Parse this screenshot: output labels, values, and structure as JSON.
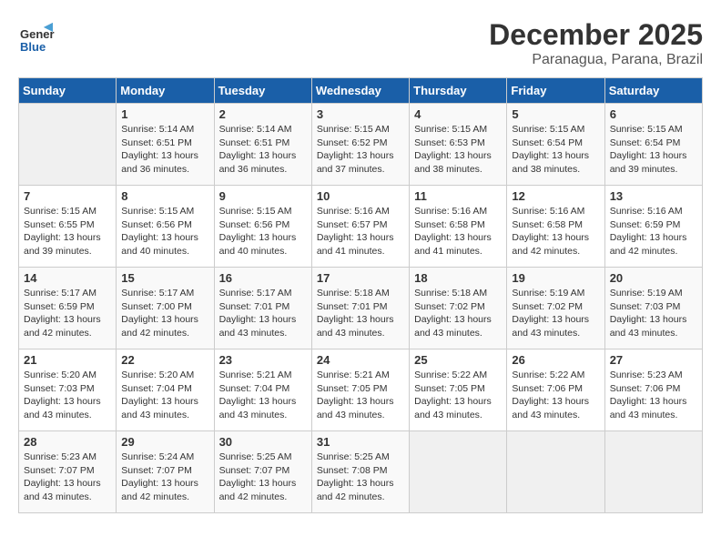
{
  "header": {
    "logo_general": "General",
    "logo_blue": "Blue",
    "month": "December 2025",
    "location": "Paranagua, Parana, Brazil"
  },
  "days_of_week": [
    "Sunday",
    "Monday",
    "Tuesday",
    "Wednesday",
    "Thursday",
    "Friday",
    "Saturday"
  ],
  "weeks": [
    [
      {
        "day": "",
        "info": ""
      },
      {
        "day": "1",
        "info": "Sunrise: 5:14 AM\nSunset: 6:51 PM\nDaylight: 13 hours\nand 36 minutes."
      },
      {
        "day": "2",
        "info": "Sunrise: 5:14 AM\nSunset: 6:51 PM\nDaylight: 13 hours\nand 36 minutes."
      },
      {
        "day": "3",
        "info": "Sunrise: 5:15 AM\nSunset: 6:52 PM\nDaylight: 13 hours\nand 37 minutes."
      },
      {
        "day": "4",
        "info": "Sunrise: 5:15 AM\nSunset: 6:53 PM\nDaylight: 13 hours\nand 38 minutes."
      },
      {
        "day": "5",
        "info": "Sunrise: 5:15 AM\nSunset: 6:54 PM\nDaylight: 13 hours\nand 38 minutes."
      },
      {
        "day": "6",
        "info": "Sunrise: 5:15 AM\nSunset: 6:54 PM\nDaylight: 13 hours\nand 39 minutes."
      }
    ],
    [
      {
        "day": "7",
        "info": "Sunrise: 5:15 AM\nSunset: 6:55 PM\nDaylight: 13 hours\nand 39 minutes."
      },
      {
        "day": "8",
        "info": "Sunrise: 5:15 AM\nSunset: 6:56 PM\nDaylight: 13 hours\nand 40 minutes."
      },
      {
        "day": "9",
        "info": "Sunrise: 5:15 AM\nSunset: 6:56 PM\nDaylight: 13 hours\nand 40 minutes."
      },
      {
        "day": "10",
        "info": "Sunrise: 5:16 AM\nSunset: 6:57 PM\nDaylight: 13 hours\nand 41 minutes."
      },
      {
        "day": "11",
        "info": "Sunrise: 5:16 AM\nSunset: 6:58 PM\nDaylight: 13 hours\nand 41 minutes."
      },
      {
        "day": "12",
        "info": "Sunrise: 5:16 AM\nSunset: 6:58 PM\nDaylight: 13 hours\nand 42 minutes."
      },
      {
        "day": "13",
        "info": "Sunrise: 5:16 AM\nSunset: 6:59 PM\nDaylight: 13 hours\nand 42 minutes."
      }
    ],
    [
      {
        "day": "14",
        "info": "Sunrise: 5:17 AM\nSunset: 6:59 PM\nDaylight: 13 hours\nand 42 minutes."
      },
      {
        "day": "15",
        "info": "Sunrise: 5:17 AM\nSunset: 7:00 PM\nDaylight: 13 hours\nand 42 minutes."
      },
      {
        "day": "16",
        "info": "Sunrise: 5:17 AM\nSunset: 7:01 PM\nDaylight: 13 hours\nand 43 minutes."
      },
      {
        "day": "17",
        "info": "Sunrise: 5:18 AM\nSunset: 7:01 PM\nDaylight: 13 hours\nand 43 minutes."
      },
      {
        "day": "18",
        "info": "Sunrise: 5:18 AM\nSunset: 7:02 PM\nDaylight: 13 hours\nand 43 minutes."
      },
      {
        "day": "19",
        "info": "Sunrise: 5:19 AM\nSunset: 7:02 PM\nDaylight: 13 hours\nand 43 minutes."
      },
      {
        "day": "20",
        "info": "Sunrise: 5:19 AM\nSunset: 7:03 PM\nDaylight: 13 hours\nand 43 minutes."
      }
    ],
    [
      {
        "day": "21",
        "info": "Sunrise: 5:20 AM\nSunset: 7:03 PM\nDaylight: 13 hours\nand 43 minutes."
      },
      {
        "day": "22",
        "info": "Sunrise: 5:20 AM\nSunset: 7:04 PM\nDaylight: 13 hours\nand 43 minutes."
      },
      {
        "day": "23",
        "info": "Sunrise: 5:21 AM\nSunset: 7:04 PM\nDaylight: 13 hours\nand 43 minutes."
      },
      {
        "day": "24",
        "info": "Sunrise: 5:21 AM\nSunset: 7:05 PM\nDaylight: 13 hours\nand 43 minutes."
      },
      {
        "day": "25",
        "info": "Sunrise: 5:22 AM\nSunset: 7:05 PM\nDaylight: 13 hours\nand 43 minutes."
      },
      {
        "day": "26",
        "info": "Sunrise: 5:22 AM\nSunset: 7:06 PM\nDaylight: 13 hours\nand 43 minutes."
      },
      {
        "day": "27",
        "info": "Sunrise: 5:23 AM\nSunset: 7:06 PM\nDaylight: 13 hours\nand 43 minutes."
      }
    ],
    [
      {
        "day": "28",
        "info": "Sunrise: 5:23 AM\nSunset: 7:07 PM\nDaylight: 13 hours\nand 43 minutes."
      },
      {
        "day": "29",
        "info": "Sunrise: 5:24 AM\nSunset: 7:07 PM\nDaylight: 13 hours\nand 42 minutes."
      },
      {
        "day": "30",
        "info": "Sunrise: 5:25 AM\nSunset: 7:07 PM\nDaylight: 13 hours\nand 42 minutes."
      },
      {
        "day": "31",
        "info": "Sunrise: 5:25 AM\nSunset: 7:08 PM\nDaylight: 13 hours\nand 42 minutes."
      },
      {
        "day": "",
        "info": ""
      },
      {
        "day": "",
        "info": ""
      },
      {
        "day": "",
        "info": ""
      }
    ]
  ]
}
